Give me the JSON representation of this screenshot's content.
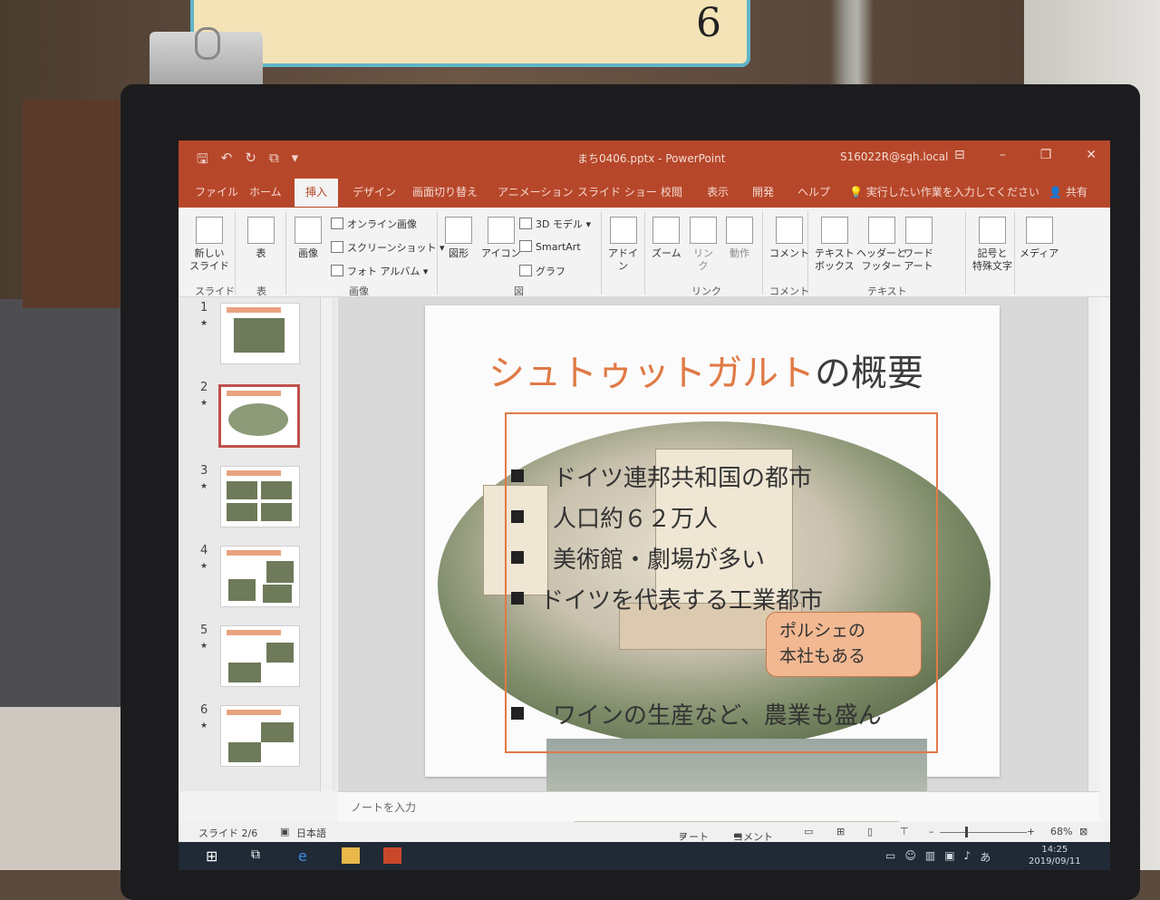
{
  "tag": {
    "number": "6"
  },
  "window": {
    "doc_title": "まち0406.pptx  -  PowerPoint",
    "account": "S16022R@sgh.local"
  },
  "tabs": [
    "ファイル",
    "ホーム",
    "挿入",
    "デザイン",
    "画面切り替え",
    "アニメーション",
    "スライド ショー",
    "校閲",
    "表示",
    "開発",
    "ヘルプ"
  ],
  "active_tab": "挿入",
  "tellme": "実行したい作業を入力してください",
  "share": "共有",
  "ribbon": {
    "new_slide": "新しい\nスライド",
    "table": "表",
    "image": "画像",
    "online_image": "オンライン画像",
    "screenshot": "スクリーンショット",
    "photo_album": "フォト アルバム",
    "shapes": "図形",
    "icons": "アイコン",
    "model3d": "3D モデル",
    "smartart": "SmartArt",
    "graph": "グラフ",
    "addin": "アドイ\nン",
    "zoom": "ズーム",
    "link": "リン\nク",
    "action": "動作",
    "comment": "コメント",
    "textbox": "テキスト\nボックス",
    "header_footer": "ヘッダーと\nフッター",
    "wordart": "ワード\nアート",
    "symbol": "記号と\n特殊文字",
    "media": "メディア",
    "groups": {
      "slide": "スライド",
      "table": "表",
      "image": "画像",
      "figure": "図",
      "link": "リンク",
      "comment": "コメント",
      "text": "テキスト"
    }
  },
  "thumbnails": [
    {
      "num": "1",
      "star": "★"
    },
    {
      "num": "2",
      "star": "★"
    },
    {
      "num": "3",
      "star": "★"
    },
    {
      "num": "4",
      "star": "★"
    },
    {
      "num": "5",
      "star": "★"
    },
    {
      "num": "6",
      "star": "★"
    }
  ],
  "slide": {
    "title_accent": "シュトゥットガルト",
    "title_rest": "の概要",
    "bullets": [
      "ドイツ連邦共和国の都市",
      "人口約６２万人",
      "美術館・劇場が多い",
      "ドイツを代表する工業都市",
      "ワインの生産など、農業も盛ん"
    ],
    "callout": [
      "ポルシェの",
      "本社もある"
    ]
  },
  "notes_placeholder": "ノートを入力",
  "status": {
    "slide_info": "スライド 2/6",
    "language": "日本語",
    "notes_btn": "ノート",
    "comment_btn": "コメント",
    "zoom": "68%"
  },
  "taskbar": {
    "time": "14:25",
    "date": "2019/09/11",
    "ime": "あ"
  },
  "colors": {
    "ppt_red": "#b7472a",
    "title_orange": "#e07a46",
    "callout_fill": "#f2b892"
  }
}
